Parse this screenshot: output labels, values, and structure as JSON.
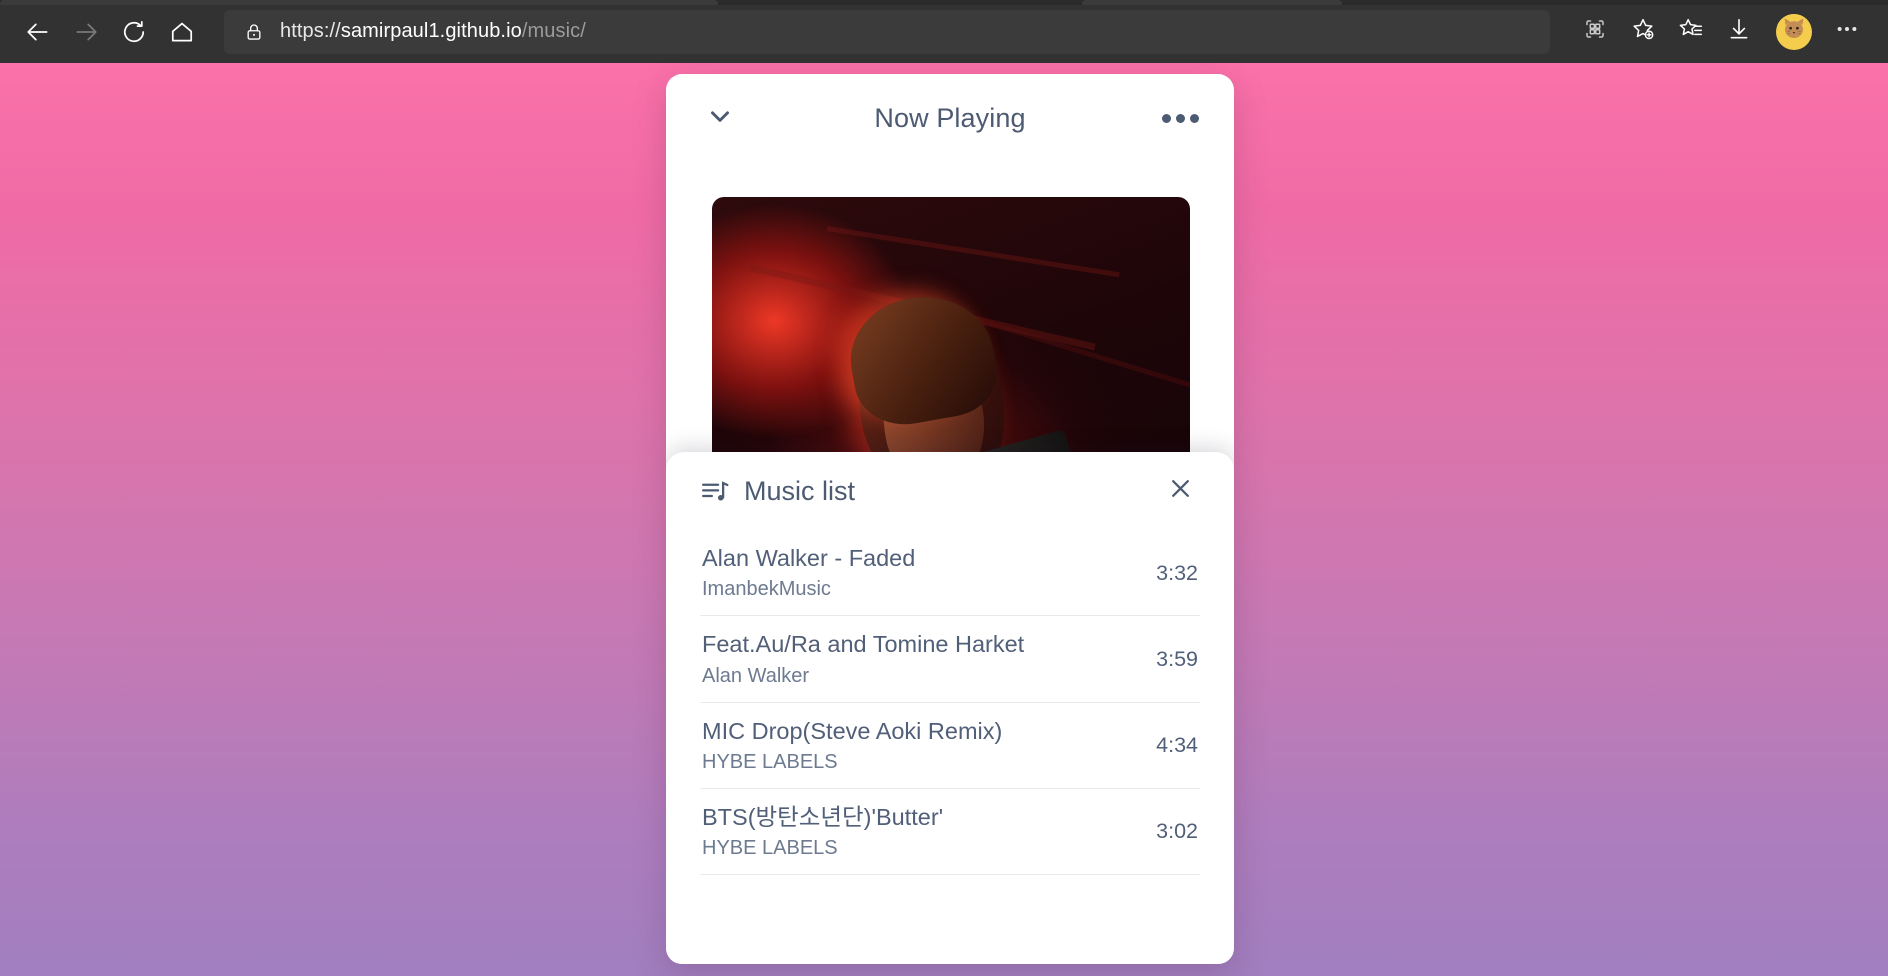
{
  "browser": {
    "nav": {
      "back_icon": "arrow-left-icon",
      "forward_icon": "arrow-right-icon",
      "refresh_icon": "refresh-icon",
      "home_icon": "home-icon"
    },
    "address": {
      "lock_icon": "lock-icon",
      "url_scheme": "https://",
      "url_host": "samirpaul1.github.io",
      "url_path": "/music/",
      "full_url": "https://samirpaul1.github.io/music/"
    },
    "toolbar": {
      "split_screen_icon": "split-screen-icon",
      "add_favorite_icon": "add-to-favorites-star-icon",
      "favorites_icon": "favorites-list-icon",
      "downloads_icon": "downloads-icon",
      "profile_icon": "cat-avatar-icon",
      "more_icon": "more-settings-icon"
    }
  },
  "player": {
    "header": {
      "collapse_icon": "chevron-down-icon",
      "title": "Now Playing",
      "options_icon": "more-options-icon"
    },
    "artwork": {
      "alt": "concert-singer-red-stage-lighting"
    }
  },
  "music_list": {
    "queue_icon": "queue-music-icon",
    "title": "Music list",
    "close_icon": "close-icon",
    "tracks": [
      {
        "title": "Alan Walker - Faded",
        "artist": "ImanbekMusic",
        "duration": "3:32"
      },
      {
        "title": "Feat.Au/Ra and Tomine Harket",
        "artist": "Alan Walker",
        "duration": "3:59"
      },
      {
        "title": "MIC Drop(Steve Aoki Remix)",
        "artist": "HYBE LABELS",
        "duration": "4:34"
      },
      {
        "title": "BTS(방탄소년단)'Butter'",
        "artist": "HYBE LABELS",
        "duration": "3:02"
      }
    ]
  },
  "theme": {
    "chrome_bg": "#323232",
    "address_bg": "#3b3b3b",
    "page_gradient_top": "#fb71a9",
    "page_gradient_bottom": "#a17fc0",
    "card_bg": "#ffffff",
    "text_primary": "#4c5a72",
    "text_secondary": "#6d7a90",
    "divider": "#e9e9ee"
  }
}
